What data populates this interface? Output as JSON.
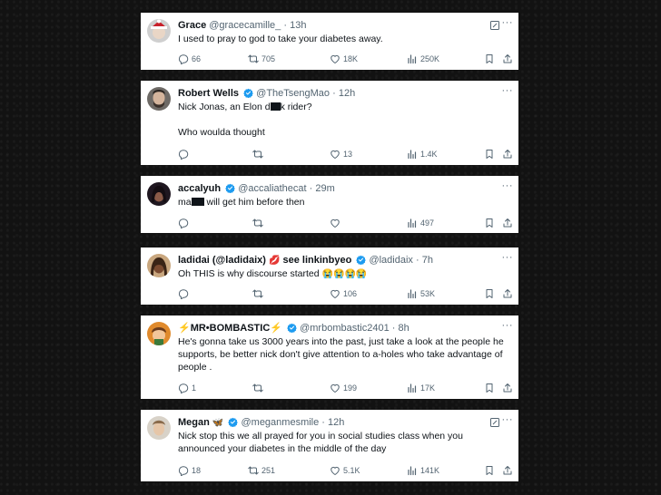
{
  "colors": {
    "verified": "#1d9bf0",
    "text": "#0f1419",
    "meta": "#536471",
    "card_bg": "#ffffff",
    "page_bg": "#121212"
  },
  "tweets": [
    {
      "name": "Grace",
      "handle": "@gracecamille_",
      "time": "13h",
      "text_parts": [
        "I used to pray to god to take your diabetes away."
      ],
      "replies": "66",
      "retweets": "705",
      "likes": "18K",
      "views": "250K",
      "verified": false,
      "grok_icon": true
    },
    {
      "name": "Robert Wells",
      "handle": "@TheTsengMao",
      "time": "12h",
      "text_a": "Nick Jonas, an Elon d",
      "text_b": "k rider?",
      "text_line2": "Who woulda thought",
      "replies": "",
      "retweets": "",
      "likes": "13",
      "views": "1.4K",
      "verified": true,
      "grok_icon": false
    },
    {
      "name": "accalyuh",
      "handle": "@accaliathecat",
      "time": "29m",
      "text_a": "ma",
      "text_b": " will get him before then",
      "replies": "",
      "retweets": "",
      "likes": "",
      "views": "497",
      "verified": true,
      "grok_icon": false
    },
    {
      "name": "ladidai (@ladidaix)",
      "name_suffix": "see linkinbyeo",
      "handle": "@ladidaix",
      "time": "7h",
      "text": "Oh THIS is why discourse started",
      "emojis": "😭😭😭😭",
      "replies": "",
      "retweets": "",
      "likes": "106",
      "views": "53K",
      "verified": true,
      "grok_icon": false
    },
    {
      "name": "⚡MR•BOMBASTIC⚡",
      "handle": "@mrbombastic2401",
      "time": "8h",
      "text": "He's gonna take us 3000 years into the past, just take a look at the people he supports, be better nick don't give attention to a-holes who take advantage of people .",
      "replies": "1",
      "retweets": "",
      "likes": "199",
      "views": "17K",
      "verified": true,
      "grok_icon": false
    },
    {
      "name": "Megan",
      "name_emoji": "🦋",
      "handle": "@meganmesmile",
      "time": "12h",
      "text": "Nick stop this we all prayed for you in social studies class when you announced your diabetes in the middle of the day",
      "replies": "18",
      "retweets": "251",
      "likes": "5.1K",
      "views": "141K",
      "verified": true,
      "grok_icon": true
    }
  ],
  "separator": "·",
  "more": "···"
}
